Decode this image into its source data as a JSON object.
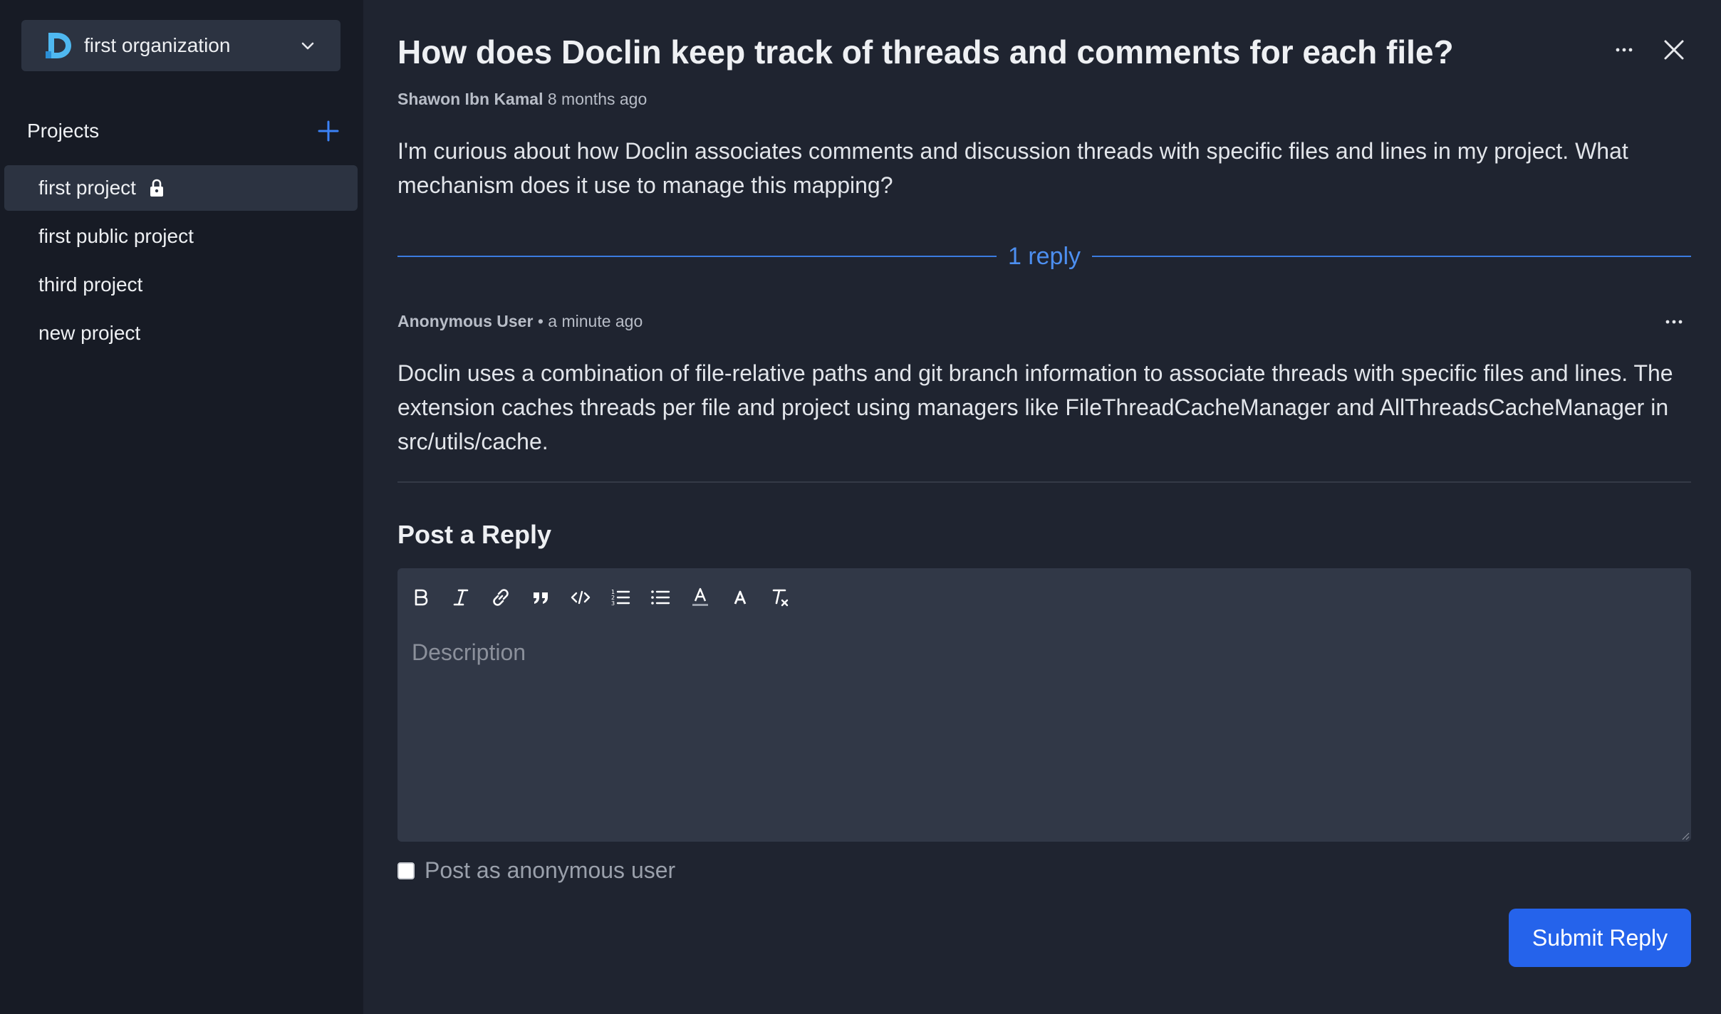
{
  "sidebar": {
    "org_name": "first organization",
    "projects_title": "Projects",
    "projects": [
      {
        "label": "first project",
        "locked": true,
        "active": true
      },
      {
        "label": "first public project",
        "locked": false,
        "active": false
      },
      {
        "label": "third project",
        "locked": false,
        "active": false
      },
      {
        "label": "new project",
        "locked": false,
        "active": false
      }
    ]
  },
  "thread": {
    "title": "How does Doclin keep track of threads and comments for each file?",
    "author": "Shawon Ibn Kamal",
    "time": "8 months ago",
    "body": "I'm curious about how Doclin associates comments and discussion threads with specific files and lines in my project. What mechanism does it use to manage this mapping?",
    "reply_count_label": "1 reply"
  },
  "reply": {
    "author": "Anonymous User",
    "separator": "•",
    "time": "a minute ago",
    "body": "Doclin uses a combination of file-relative paths and git branch information to associate threads with specific files and lines. The extension caches threads per file and project using managers like FileThreadCacheManager and AllThreadsCacheManager in src/utils/cache."
  },
  "post": {
    "title": "Post a Reply",
    "placeholder": "Description",
    "anonymous_label": "Post as anonymous user",
    "submit_label": "Submit Reply"
  },
  "colors": {
    "accent": "#2563eb",
    "reply_line": "#3b7be0",
    "sidebar_bg": "#171b25",
    "main_bg": "#1f2430"
  }
}
